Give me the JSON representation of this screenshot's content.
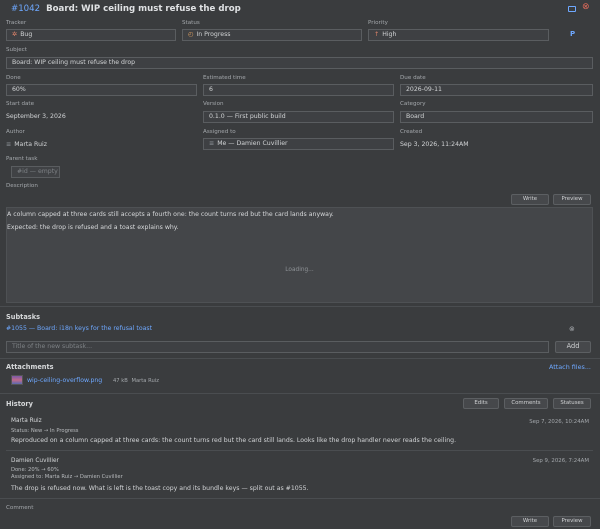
{
  "header": {
    "issue_id": "#1042",
    "title": "Board: WIP ceiling must refuse the drop",
    "accent": "#6ea8ff"
  },
  "fields": {
    "tracker": {
      "label": "Tracker",
      "value": "Bug",
      "icon": "bug-icon"
    },
    "status": {
      "label": "Status",
      "value": "In Progress",
      "icon": "in-progress-icon"
    },
    "priority": {
      "label": "Priority",
      "value": "High",
      "icon": "arrow-up-icon"
    },
    "priority_badge": "P",
    "subject": {
      "label": "Subject",
      "value": "Board: WIP ceiling must refuse the drop"
    },
    "done": {
      "label": "Done",
      "value": "60%"
    },
    "estimated": {
      "label": "Estimated time",
      "value": "6"
    },
    "due": {
      "label": "Due date",
      "value": "2026-09-11"
    },
    "start": {
      "label": "Start date",
      "value": "September 3, 2026"
    },
    "version": {
      "label": "Version",
      "value": "0.1.0 — First public build"
    },
    "category": {
      "label": "Category",
      "value": "Board"
    },
    "author": {
      "label": "Author",
      "value": "Marta Ruiz",
      "icon": "user-icon"
    },
    "assigned": {
      "label": "Assigned to",
      "value": "Me — Damien Cuvillier",
      "icon": "user-icon"
    },
    "created": {
      "label": "Created",
      "value": "Sep 3, 2026, 11:24AM"
    },
    "parent": {
      "label": "Parent task",
      "placeholder": "#id — empty"
    }
  },
  "description": {
    "label": "Description",
    "write_label": "Write",
    "preview_label": "Preview",
    "lines": [
      "A column capped at three cards still accepts a fourth one: the count turns red but the card lands anyway.",
      "Expected: the drop is refused and a toast explains why."
    ],
    "loading": "Loading..."
  },
  "subtasks": {
    "title": "Subtasks",
    "items": [
      {
        "text": "#1055 — Board: i18n keys for the refusal toast"
      }
    ],
    "new_placeholder": "Title of the new subtask...",
    "add_label": "Add"
  },
  "attachments": {
    "title": "Attachments",
    "attach_label": "Attach files...",
    "items": [
      {
        "name": "wip-ceiling-overflow.png",
        "size": "47 kB",
        "author": "Marta Ruiz"
      }
    ]
  },
  "history": {
    "title": "History",
    "tabs": [
      "Edits",
      "Comments",
      "Statuses"
    ],
    "entries": [
      {
        "author": "Marta Ruiz",
        "date": "Sep 7, 2026, 10:24AM",
        "details": [
          "Status: New → In Progress"
        ],
        "text": "Reproduced on a column capped at three cards: the count turns red but the card still lands. Looks like the drop handler never reads the ceiling."
      },
      {
        "author": "Damien Cuvillier",
        "date": "Sep 9, 2026, 7:24AM",
        "details": [
          "Done: 20% → 60%",
          "Assigned to: Marta Ruiz → Damien Cuvillier"
        ],
        "text": "The drop is refused now. What is left is the toast copy and its bundle keys — split out as #1055."
      }
    ]
  },
  "comment": {
    "label": "Comment",
    "write_label": "Write",
    "preview_label": "Preview"
  }
}
